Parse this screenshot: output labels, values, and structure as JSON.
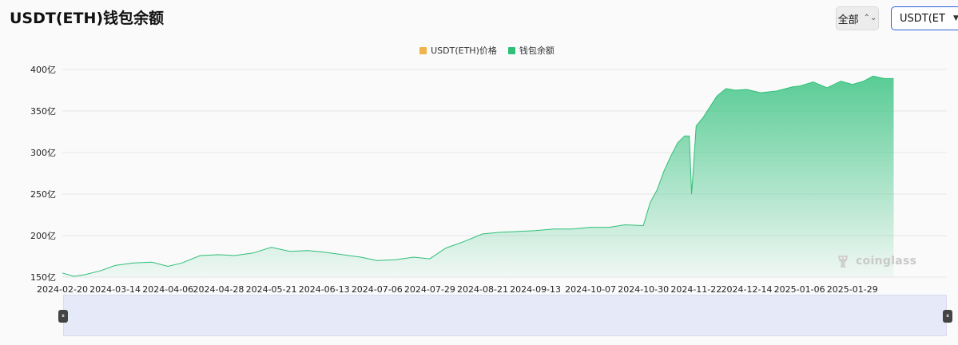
{
  "header": {
    "title": "USDT(ETH)钱包余额",
    "range_label": "全部",
    "asset_label": "USDT(ET"
  },
  "legend": [
    {
      "label": "USDT(ETH)价格",
      "color": "#f0b34a"
    },
    {
      "label": "钱包余额",
      "color": "#2fbf78"
    }
  ],
  "watermark": "coinglass",
  "chart_data": {
    "type": "area",
    "title": "USDT(ETH)钱包余额",
    "series": [
      {
        "name": "钱包余额",
        "color": "#2fbf78"
      }
    ],
    "y_ticks": [
      "150亿",
      "200亿",
      "250亿",
      "300亿",
      "350亿",
      "400亿"
    ],
    "y_tick_values": [
      150,
      200,
      250,
      300,
      350,
      400
    ],
    "ylim": [
      150,
      400
    ],
    "x_ticks": [
      "2024-02-20",
      "2024-03-14",
      "2024-04-06",
      "2024-04-28",
      "2024-05-21",
      "2024-06-13",
      "2024-07-06",
      "2024-07-29",
      "2024-08-21",
      "2024-09-13",
      "2024-10-07",
      "2024-10-30",
      "2024-11-22",
      "2024-12-14",
      "2025-01-06",
      "2025-01-29"
    ],
    "x": [
      "2024-02-20",
      "2024-02-25",
      "2024-03-01",
      "2024-03-08",
      "2024-03-14",
      "2024-03-22",
      "2024-03-30",
      "2024-04-06",
      "2024-04-12",
      "2024-04-20",
      "2024-04-28",
      "2024-05-05",
      "2024-05-13",
      "2024-05-21",
      "2024-05-29",
      "2024-06-06",
      "2024-06-13",
      "2024-06-21",
      "2024-06-29",
      "2024-07-06",
      "2024-07-14",
      "2024-07-22",
      "2024-07-29",
      "2024-08-05",
      "2024-08-13",
      "2024-08-21",
      "2024-08-29",
      "2024-09-06",
      "2024-09-13",
      "2024-09-21",
      "2024-09-29",
      "2024-10-07",
      "2024-10-15",
      "2024-10-22",
      "2024-10-30",
      "2024-11-02",
      "2024-11-05",
      "2024-11-08",
      "2024-11-11",
      "2024-11-14",
      "2024-11-17",
      "2024-11-19",
      "2024-11-20",
      "2024-11-22",
      "2024-11-25",
      "2024-11-28",
      "2024-12-01",
      "2024-12-05",
      "2024-12-09",
      "2024-12-14",
      "2024-12-20",
      "2024-12-27",
      "2025-01-03",
      "2025-01-06",
      "2025-01-12",
      "2025-01-18",
      "2025-01-24",
      "2025-01-29",
      "2025-02-03",
      "2025-02-07",
      "2025-02-12",
      "2025-02-16"
    ],
    "values": [
      155,
      151,
      153,
      158,
      164,
      167,
      168,
      163,
      167,
      176,
      177,
      176,
      179,
      186,
      181,
      182,
      180,
      177,
      174,
      170,
      171,
      174,
      172,
      185,
      193,
      202,
      204,
      205,
      206,
      208,
      208,
      210,
      210,
      213,
      212,
      240,
      255,
      278,
      296,
      312,
      320,
      320,
      250,
      332,
      342,
      355,
      368,
      377,
      375,
      376,
      372,
      374,
      379,
      380,
      385,
      378,
      386,
      382,
      386,
      392,
      389,
      389
    ]
  }
}
